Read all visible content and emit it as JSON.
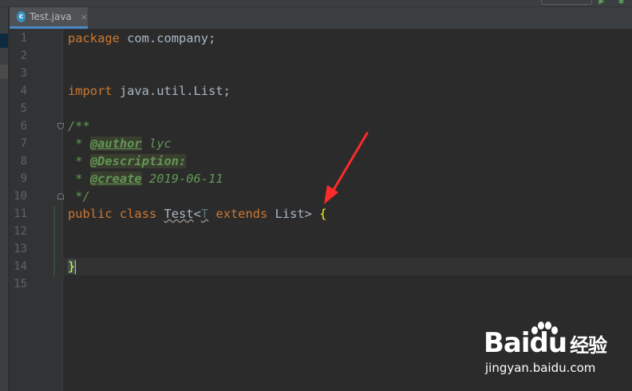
{
  "tab": {
    "icon_letter": "c",
    "label": "Test.java",
    "close": "×"
  },
  "lines": [
    {
      "n": "1"
    },
    {
      "n": "2"
    },
    {
      "n": "3"
    },
    {
      "n": "4"
    },
    {
      "n": "5"
    },
    {
      "n": "6"
    },
    {
      "n": "7"
    },
    {
      "n": "8"
    },
    {
      "n": "9"
    },
    {
      "n": "10"
    },
    {
      "n": "11"
    },
    {
      "n": "12"
    },
    {
      "n": "13"
    },
    {
      "n": "14"
    },
    {
      "n": "15"
    }
  ],
  "code": {
    "l1_kw": "package",
    "l1_rest": " com.company;",
    "l4_kw": "import",
    "l4_rest": " java.util.List;",
    "l6": "/**",
    "l7_star": " * ",
    "l7_tag": "@author",
    "l7_val": " lyc",
    "l8_star": " * ",
    "l8_tag": "@Description:",
    "l9_star": " * ",
    "l9_tag": "@create",
    "l9_val": " 2019-06-11",
    "l10": " */",
    "l11_kw1": "public",
    "l11_kw2": "class",
    "l11_name": "Test",
    "l11_lt": "<",
    "l11_T": "T",
    "l11_kw3": "extends",
    "l11_list": "List>",
    "l11_brace": "{",
    "l14_brace": "}"
  },
  "watermark": {
    "logo_text": "Bai",
    "logo_du": "du",
    "logo_cn": "经验",
    "url": "jingyan.baidu.com"
  },
  "colors": {
    "keyword": "#cc7832",
    "doc": "#629755",
    "arrow": "#ff2a2a"
  }
}
